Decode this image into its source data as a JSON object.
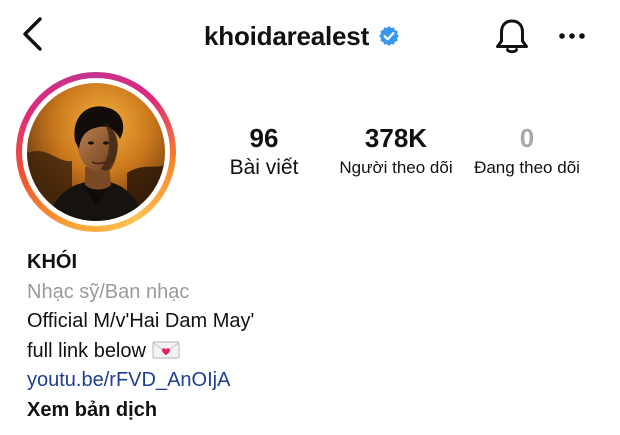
{
  "header": {
    "username": "khoidarealest",
    "verified": true,
    "icons": {
      "back": "chevron-left-icon",
      "verified": "verified-badge-icon",
      "notifications": "bell-icon",
      "more": "more-horizontal-icon"
    }
  },
  "profile": {
    "avatar": "profile-photo",
    "stats": {
      "posts": {
        "value": "96",
        "label": "Bài viết"
      },
      "followers": {
        "value": "378K",
        "label": "Người theo dõi"
      },
      "following": {
        "value": "0",
        "label": "Đang theo dõi"
      }
    }
  },
  "bio": {
    "name": "KHÓI",
    "category": "Nhạc sỹ/Ban nhạc",
    "line1": "Official M/v'Hai Dam May'",
    "line2": "full link below",
    "line2_emoji": "love-letter-icon",
    "link": "youtu.be/rFVD_AnOIjA",
    "translate": "Xem bản dịch"
  },
  "colors": {
    "text": "#111111",
    "muted": "#9a9a9a",
    "zero_count": "#a8a8a8",
    "link": "#1e3f8f",
    "verified": "#3897f0",
    "story_ring": [
      "#f7a335",
      "#f2542d",
      "#dd2a7b",
      "#fdc154"
    ]
  }
}
